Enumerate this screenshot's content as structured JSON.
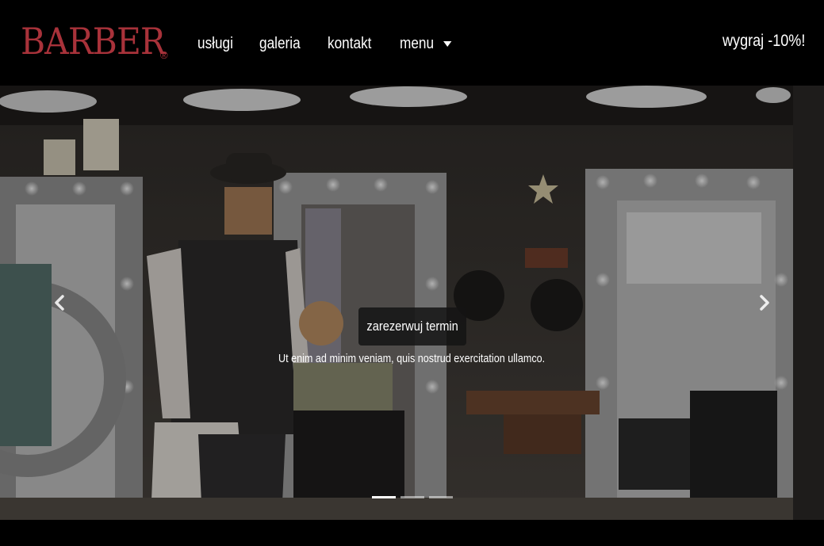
{
  "navbar": {
    "brand": "BARBER",
    "brand_mark": "®",
    "links": [
      {
        "label": "usługi"
      },
      {
        "label": "galeria"
      },
      {
        "label": "kontakt"
      },
      {
        "label": "menu"
      }
    ],
    "promo": "wygraj -10%!"
  },
  "carousel": {
    "button_label": "zarezerwuj termin",
    "caption": "Ut enim ad minim veniam, quis nostrud exercitation ullamco.",
    "slides_count": 3,
    "active_slide": 1,
    "prev_icon": "chevron-left-icon",
    "next_icon": "chevron-right-icon"
  },
  "colors": {
    "brand": "#a8323a",
    "background": "#000000",
    "text": "#ffffff"
  }
}
